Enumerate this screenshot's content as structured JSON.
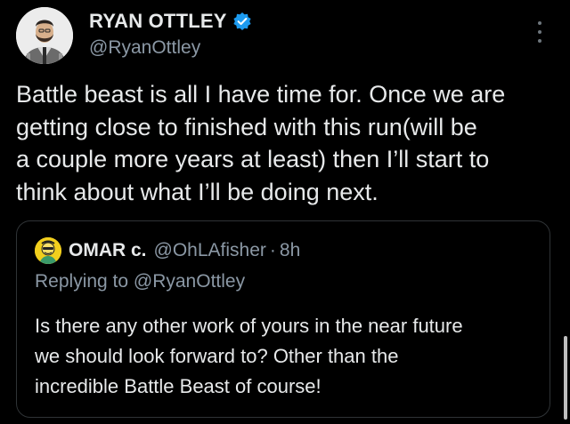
{
  "tweet": {
    "author": {
      "display_name": "RYAN OTTLEY",
      "handle": "@RyanOttley",
      "verified": true,
      "avatar_icon": "user-avatar"
    },
    "more_icon": "more-options-icon",
    "text_lines": [
      "Battle beast is all I have time for. Once we are",
      "getting close to finished with this run(will be",
      "a couple more years at least) then I’ll start to",
      "think about what I’ll be doing next."
    ]
  },
  "quoted_tweet": {
    "author": {
      "display_name": "OMAR c.",
      "handle": "@OhLAfisher",
      "separator": "·",
      "time": "8h",
      "avatar_icon": "user-avatar"
    },
    "replying_to": "Replying to @RyanOttley",
    "text_lines": [
      "Is there any other work of yours in the near future",
      "we should look forward to? Other than the",
      "incredible Battle Beast of course!"
    ]
  },
  "colors": {
    "background": "#000000",
    "primary_text": "#e7e9ea",
    "secondary_text": "#8b98a5",
    "border": "#2f3336",
    "verified_badge": "#1d9bf0",
    "avatar_bg_quote": "#f2cf1d"
  }
}
